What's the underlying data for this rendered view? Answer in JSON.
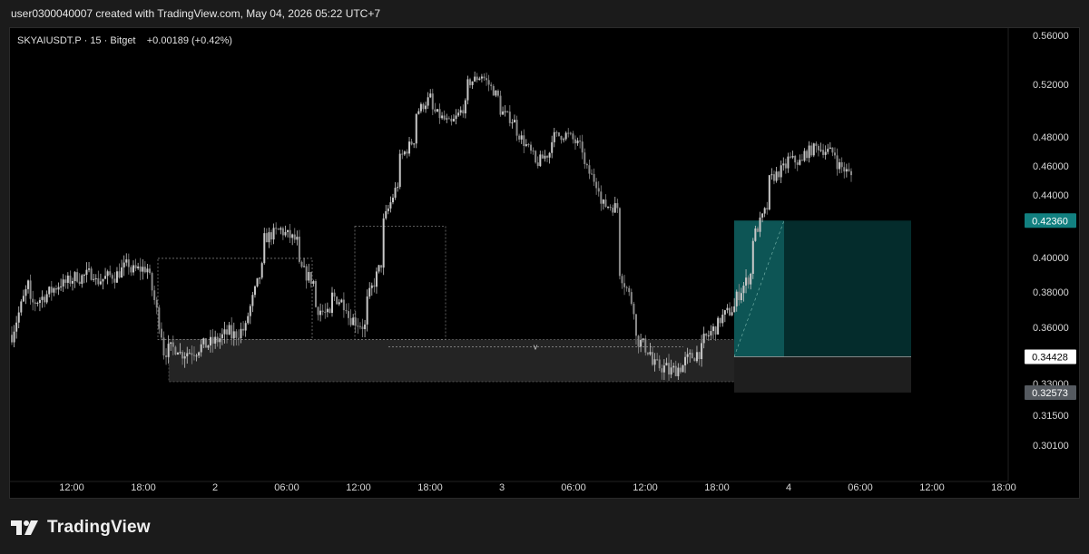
{
  "header": {
    "credit": "user0300040007 created with TradingView.com, May 04, 2026 05:22 UTC+7"
  },
  "legend": {
    "symbol": "SKYAIUSDT.P",
    "interval": "15",
    "exchange": "Bitget",
    "change": "+0.00189 (+0.42%)"
  },
  "brand": {
    "name": "TradingView",
    "logo": "tradingview-logo-icon"
  },
  "colors": {
    "background": "#000000",
    "candle": "#9a9a9a",
    "zone": "#2a2a2a",
    "target": "#0e5a5a",
    "target_box": "#042c2c",
    "stop": "#1e1e1e",
    "price_label_target": "#128080"
  },
  "chart_data": {
    "type": "candlestick",
    "y_axis": {
      "ticks": [
        {
          "value": 0.56,
          "label": "0.56000"
        },
        {
          "value": 0.52,
          "label": "0.52000"
        },
        {
          "value": 0.48,
          "label": "0.48000"
        },
        {
          "value": 0.46,
          "label": "0.46000"
        },
        {
          "value": 0.44,
          "label": "0.44000"
        },
        {
          "value": 0.4,
          "label": "0.40000"
        },
        {
          "value": 0.38,
          "label": "0.38000"
        },
        {
          "value": 0.36,
          "label": "0.36000"
        },
        {
          "value": 0.33,
          "label": "0.33000"
        },
        {
          "value": 0.315,
          "label": "0.31500"
        },
        {
          "value": 0.301,
          "label": "0.30100"
        }
      ],
      "price_labels": [
        {
          "value": 0.4236,
          "label": "0.42360",
          "style": "target"
        },
        {
          "value": 0.34428,
          "label": "0.34428",
          "style": "current"
        },
        {
          "value": 0.32573,
          "label": "0.32573",
          "style": "stop"
        }
      ]
    },
    "x_axis": {
      "ticks": [
        "12:00",
        "18:00",
        "2",
        "06:00",
        "12:00",
        "18:00",
        "3",
        "06:00",
        "12:00",
        "18:00",
        "4",
        "06:00",
        "12:00",
        "18:00"
      ]
    },
    "price_path": [
      [
        0.356,
        0.385
      ],
      [
        0.372,
        0.378
      ],
      [
        0.378,
        0.386
      ],
      [
        0.384,
        0.39
      ],
      [
        0.388,
        0.392
      ],
      [
        0.386,
        0.39
      ],
      [
        0.388,
        0.397
      ],
      [
        0.392,
        0.394
      ],
      [
        0.396,
        0.352
      ],
      [
        0.347,
        0.35
      ],
      [
        0.346,
        0.348
      ],
      [
        0.349,
        0.352
      ],
      [
        0.352,
        0.358
      ],
      [
        0.355,
        0.36
      ],
      [
        0.366,
        0.398
      ],
      [
        0.412,
        0.418
      ],
      [
        0.417,
        0.41
      ],
      [
        0.395,
        0.385
      ],
      [
        0.372,
        0.365
      ],
      [
        0.378,
        0.372
      ],
      [
        0.366,
        0.36
      ],
      [
        0.372,
        0.398
      ],
      [
        0.42,
        0.45
      ],
      [
        0.464,
        0.48
      ],
      [
        0.498,
        0.512
      ],
      [
        0.5,
        0.49
      ],
      [
        0.488,
        0.505
      ],
      [
        0.52,
        0.528
      ],
      [
        0.526,
        0.508
      ],
      [
        0.5,
        0.49
      ],
      [
        0.484,
        0.466
      ],
      [
        0.46,
        0.47
      ],
      [
        0.48,
        0.482
      ],
      [
        0.482,
        0.47
      ],
      [
        0.46,
        0.444
      ],
      [
        0.434,
        0.432
      ],
      [
        0.395,
        0.37
      ],
      [
        0.355,
        0.346
      ],
      [
        0.34,
        0.338
      ],
      [
        0.336,
        0.34
      ],
      [
        0.342,
        0.348
      ],
      [
        0.352,
        0.362
      ],
      [
        0.364,
        0.372
      ],
      [
        0.376,
        0.392
      ],
      [
        0.412,
        0.435
      ],
      [
        0.45,
        0.46
      ],
      [
        0.465,
        0.462
      ],
      [
        0.468,
        0.474
      ],
      [
        0.472,
        0.468
      ],
      [
        0.462,
        0.452
      ]
    ],
    "zones": [
      {
        "name": "demand-zone",
        "y1": 0.3535,
        "y2": 0.331
      },
      {
        "name": "resistance-box-1",
        "y1": 0.3995,
        "y2": 0.3535
      },
      {
        "name": "resistance-box-2",
        "y1": 0.42,
        "y2": 0.3535
      }
    ],
    "position": {
      "entry": 0.34428,
      "target": 0.4236,
      "stop": 0.32573
    },
    "annotation": "v"
  }
}
